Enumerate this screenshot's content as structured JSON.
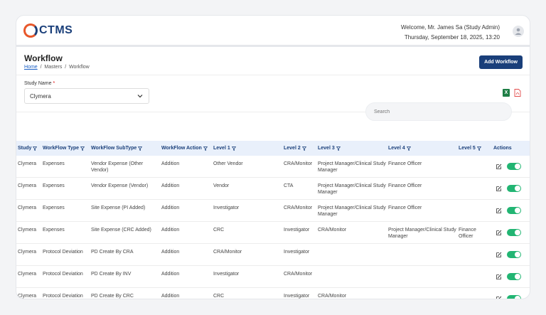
{
  "header": {
    "logo_text": "CTMS",
    "welcome": "Welcome, Mr. James Sa (Study Admin)",
    "datetime": "Thursday, September 18, 2025, 13:20"
  },
  "page": {
    "title": "Workflow",
    "breadcrumb": {
      "home": "Home",
      "sep": "/",
      "masters": "Masters",
      "current": "Workflow"
    },
    "add_button": "Add Workflow"
  },
  "filter": {
    "study_label": "Study Name",
    "required_mark": "*",
    "study_value": "Clymera",
    "excel_glyph": "X"
  },
  "search": {
    "placeholder": "Search"
  },
  "table": {
    "columns": [
      "Study",
      "WorkFlow Type",
      "WorkFlow SubType",
      "WorkFlow Action",
      "Level 1",
      "Level 2",
      "Level 3",
      "Level 4",
      "Level 5",
      "Actions"
    ],
    "rows": [
      [
        "Clymera",
        "Expenses",
        "Vendor Expense (Other Vendor)",
        "Addition",
        "Other Vendor",
        "CRA/Monitor",
        "Project Manager/Clinical Study Manager",
        "Finance Officer",
        ""
      ],
      [
        "Clymera",
        "Expenses",
        "Vendor Expense (Vendor)",
        "Addition",
        "Vendor",
        "CTA",
        "Project Manager/Clinical Study Manager",
        "Finance Officer",
        ""
      ],
      [
        "Clymera",
        "Expenses",
        "Site Expense (PI Added)",
        "Addition",
        "Investigator",
        "CRA/Monitor",
        "Project Manager/Clinical Study Manager",
        "Finance Officer",
        ""
      ],
      [
        "Clymera",
        "Expenses",
        "Site Expense (CRC Added)",
        "Addition",
        "CRC",
        "Investigator",
        "CRA/Monitor",
        "Project Manager/Clinical Study Manager",
        "Finance Officer"
      ],
      [
        "Clymera",
        "Protocol Deviation",
        "PD Create By CRA",
        "Addition",
        "CRA/Monitor",
        "Investigator",
        "",
        "",
        ""
      ],
      [
        "Clymera",
        "Protocol Deviation",
        "PD Create By INV",
        "Addition",
        "Investigator",
        "CRA/Monitor",
        "",
        "",
        ""
      ],
      [
        "Clymera",
        "Protocol Deviation",
        "PD Create By CRC",
        "Addition",
        "CRC",
        "Investigator",
        "CRA/Monitor",
        "",
        ""
      ]
    ]
  },
  "colors": {
    "brand_navy": "#1a3f7a",
    "brand_orange": "#e8572a",
    "toggle_on": "#22b573",
    "excel": "#1e7e45",
    "pdf": "#e34b4b"
  }
}
